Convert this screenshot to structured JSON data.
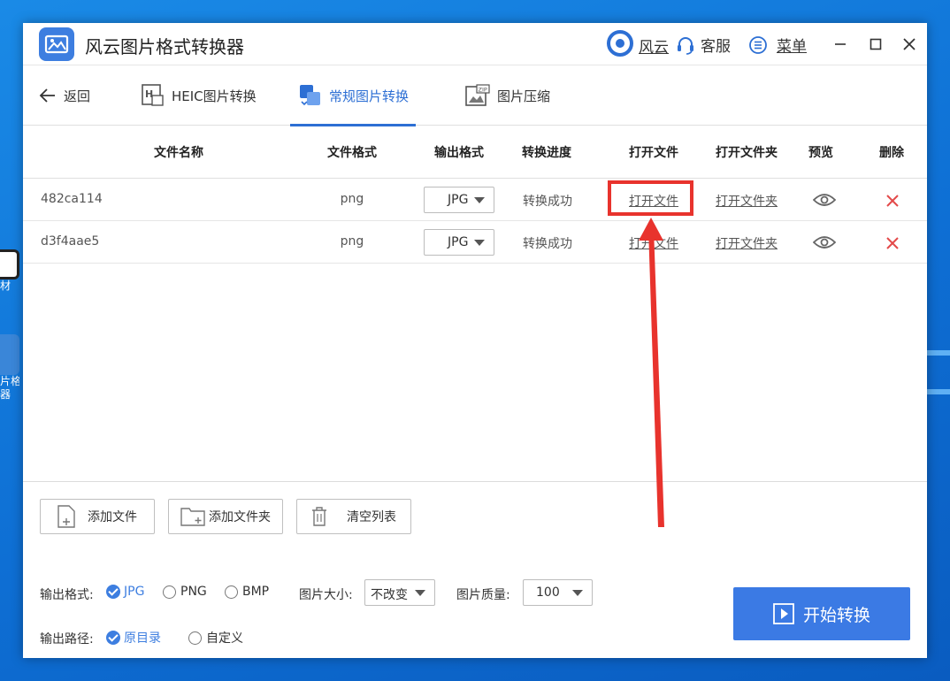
{
  "desktop": {
    "icon1_label": "材",
    "icon2_label": "片格式\n器"
  },
  "titlebar": {
    "app_title": "风云图片格式转换器",
    "user_label": "风云",
    "service_label": "客服",
    "menu_label": "菜单"
  },
  "tabs": {
    "back": "返回",
    "heic": "HEIC图片转换",
    "normal": "常规图片转换",
    "compress": "图片压缩"
  },
  "table": {
    "headers": [
      "文件名称",
      "文件格式",
      "输出格式",
      "转换进度",
      "打开文件",
      "打开文件夹",
      "预览",
      "删除"
    ],
    "rows": [
      {
        "name": "482ca114",
        "format": "png",
        "output": "JPG",
        "status": "转换成功",
        "open": "打开文件",
        "open_folder": "打开文件夹"
      },
      {
        "name": "d3f4aae5",
        "format": "png",
        "output": "JPG",
        "status": "转换成功",
        "open": "打开文件",
        "open_folder": "打开文件夹"
      }
    ]
  },
  "actions": {
    "add_file": "添加文件",
    "add_folder": "添加文件夹",
    "clear_list": "清空列表"
  },
  "output_format": {
    "label": "输出格式:",
    "options": [
      "JPG",
      "PNG",
      "BMP"
    ],
    "selected": "JPG"
  },
  "image_size": {
    "label": "图片大小:",
    "value": "不改变"
  },
  "image_quality": {
    "label": "图片质量:",
    "value": "100"
  },
  "output_path": {
    "label": "输出路径:",
    "options": [
      "原目录",
      "自定义"
    ],
    "selected": "原目录"
  },
  "start_button": "开始转换",
  "colors": {
    "accent": "#3b7ae4",
    "annotation": "#e8332d",
    "delete": "#e34a4a"
  }
}
